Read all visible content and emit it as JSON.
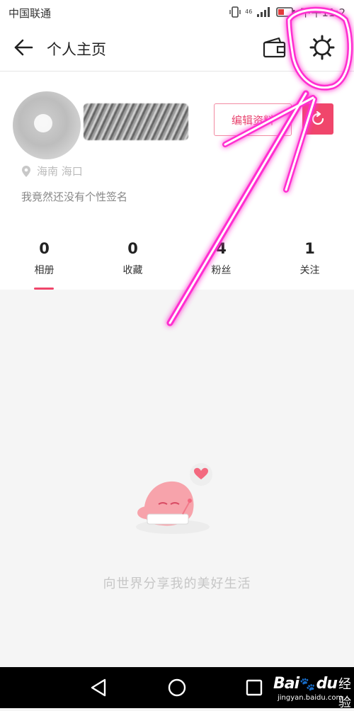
{
  "status_bar": {
    "carrier": "中国联通",
    "network": "46",
    "time": "下午11:2"
  },
  "header": {
    "title": "个人主页",
    "icons": [
      "back-arrow-icon",
      "wallet-icon",
      "settings-gear-icon"
    ]
  },
  "profile": {
    "edit_label": "编辑资料",
    "location": "海南 海口",
    "bio": "我竟然还没有个性签名"
  },
  "stats": [
    {
      "count": "0",
      "label": "相册"
    },
    {
      "count": "0",
      "label": "收藏"
    },
    {
      "count": "4",
      "label": "粉丝"
    },
    {
      "count": "1",
      "label": "关注"
    }
  ],
  "active_tab": "相册",
  "empty_state": {
    "message": "向世界分享我的美好生活"
  },
  "nav_bar": {
    "icons": [
      "nav-back-icon",
      "nav-home-icon",
      "nav-recent-icon"
    ]
  },
  "watermark": {
    "brand": "Bai",
    "brand_suffix": "du",
    "product": "经验",
    "url": "jingyan.baidu.com"
  },
  "colors": {
    "accent": "#f0466b",
    "annotation": "#ff2fd0"
  }
}
